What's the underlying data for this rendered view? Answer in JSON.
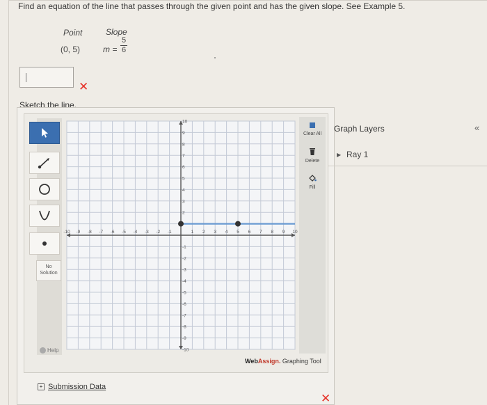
{
  "question": {
    "text": "Find an equation of the line that passes through the given point and has the given slope. See Example 5.",
    "point_header": "Point",
    "slope_header": "Slope",
    "point_value": "(0, 5)",
    "slope_prefix": "m =",
    "slope_numerator": "5",
    "slope_denominator": "6"
  },
  "answer": {
    "value": ""
  },
  "sketch_label": "Sketch the line.",
  "tools": [
    {
      "name": "pointer",
      "icon": "arrow-pointer-icon",
      "active": true
    },
    {
      "name": "line",
      "icon": "line-segment-icon"
    },
    {
      "name": "circle",
      "icon": "circle-icon"
    },
    {
      "name": "parabola",
      "icon": "parabola-icon"
    },
    {
      "name": "point",
      "icon": "point-icon"
    }
  ],
  "no_solution_label": {
    "line1": "No",
    "line2": "Solution"
  },
  "help_label": "Help",
  "right_tools": {
    "clear_all": "Clear All",
    "delete": "Delete",
    "fill": "Fill"
  },
  "graph": {
    "xlim": [
      -10,
      10
    ],
    "ylim": [
      -10,
      10
    ],
    "x_ticks": [
      "-10",
      "-9",
      "-8",
      "-7",
      "-6",
      "-5",
      "-4",
      "-3",
      "-2",
      "-1",
      "1",
      "2",
      "3",
      "4",
      "5",
      "6",
      "7",
      "8",
      "9",
      "10"
    ],
    "y_ticks": [
      "10",
      "9",
      "8",
      "7",
      "6",
      "5",
      "4",
      "3",
      "2",
      "-1",
      "-2",
      "-3",
      "-4",
      "-5",
      "-6",
      "-7",
      "-8",
      "-9",
      "-10"
    ],
    "ray": {
      "start": [
        0,
        1
      ],
      "through": [
        5,
        1
      ],
      "color": "#6a9bd2"
    }
  },
  "branding": {
    "web": "Web",
    "assign": "Assign.",
    "tool": "Graphing Tool"
  },
  "layers_panel": {
    "title": "Graph Layers",
    "collapse": "«",
    "item": "Ray 1"
  },
  "submission_data": "Submission Data",
  "colors": {
    "error_x": "#e6332a",
    "active_tool": "#3b6fb0",
    "ray": "#6a9bd2"
  }
}
